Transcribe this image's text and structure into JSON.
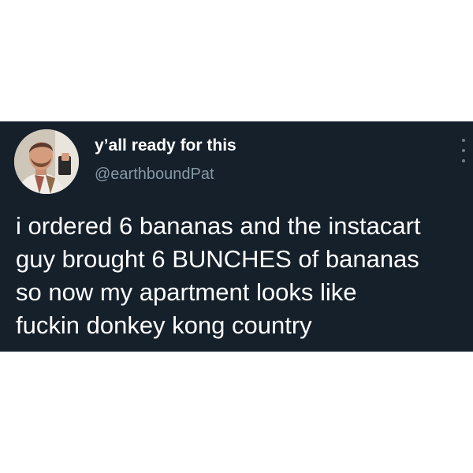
{
  "tweet": {
    "display_name": "y’all ready for this",
    "handle": "@earthboundPat",
    "text_lines": [
      "i ordered 6 bananas and the instacart",
      "guy brought 6 BUNCHES of bananas",
      "so now my apartment looks like",
      "fuckin donkey kong country"
    ],
    "avatar_icon": "profile-photo",
    "more_icon": "vertical-ellipsis-icon"
  },
  "colors": {
    "page_background": "#ffffff",
    "card_background": "#15202b",
    "primary_text": "#ffffff",
    "secondary_text": "#8899a6"
  }
}
